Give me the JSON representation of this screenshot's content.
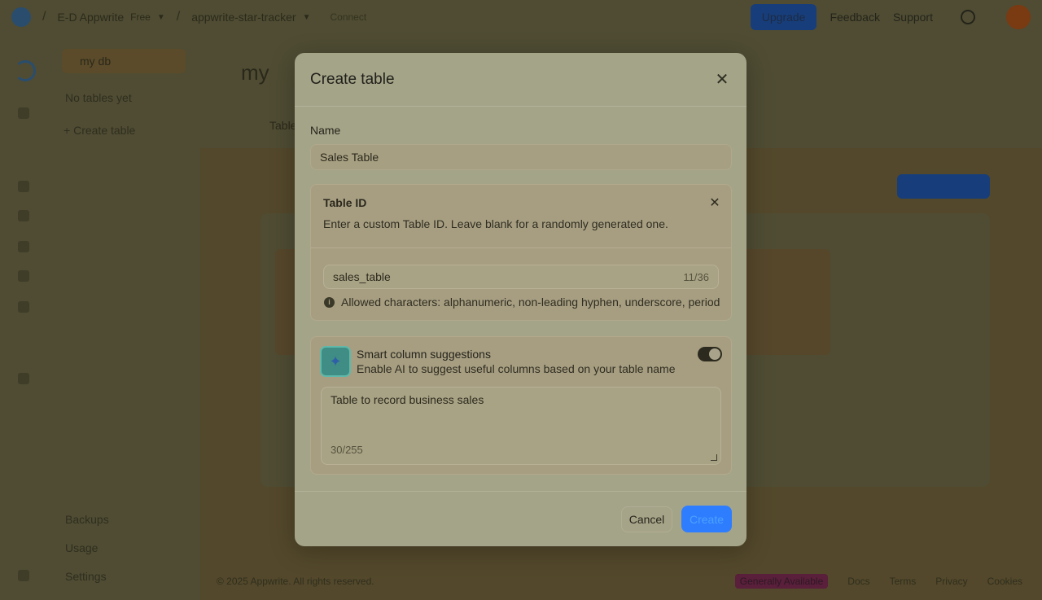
{
  "topbar": {
    "org_name": "E-D Appwrite",
    "plan_badge": "Free",
    "project_name": "appwrite-star-tracker",
    "connect_label": "Connect",
    "upgrade_label": "Upgrade",
    "feedback_label": "Feedback",
    "support_label": "Support"
  },
  "leftnav": {
    "database_name": "my db",
    "empty_text": "No tables yet",
    "create_table_label": "Create table",
    "bottom_items": [
      {
        "label": "Backups"
      },
      {
        "label": "Usage"
      },
      {
        "label": "Settings"
      }
    ]
  },
  "main": {
    "title": "my",
    "tab_label": "Table"
  },
  "footer": {
    "copyright": "© 2025 Appwrite. All rights reserved.",
    "status_badge": "Generally Available",
    "links": [
      "Docs",
      "Terms",
      "Privacy",
      "Cookies"
    ]
  },
  "modal": {
    "title": "Create table",
    "name_label": "Name",
    "name_value": "Sales Table",
    "table_id": {
      "title": "Table ID",
      "description": "Enter a custom Table ID. Leave blank for a randomly generated one.",
      "value": "sales_table",
      "counter": "11/36",
      "hint": "Allowed characters: alphanumeric, non-leading hyphen, underscore, period"
    },
    "smart_columns": {
      "title": "Smart column suggestions",
      "description": "Enable AI to suggest useful columns based on your table name",
      "enabled": true,
      "prompt_value": "Table to record business sales",
      "counter": "30/255"
    },
    "cancel_label": "Cancel",
    "create_label": "Create"
  },
  "colors": {
    "accent": "#2f7dff",
    "modal_bg": "#a4a489",
    "overlay": "#4f4c33"
  }
}
